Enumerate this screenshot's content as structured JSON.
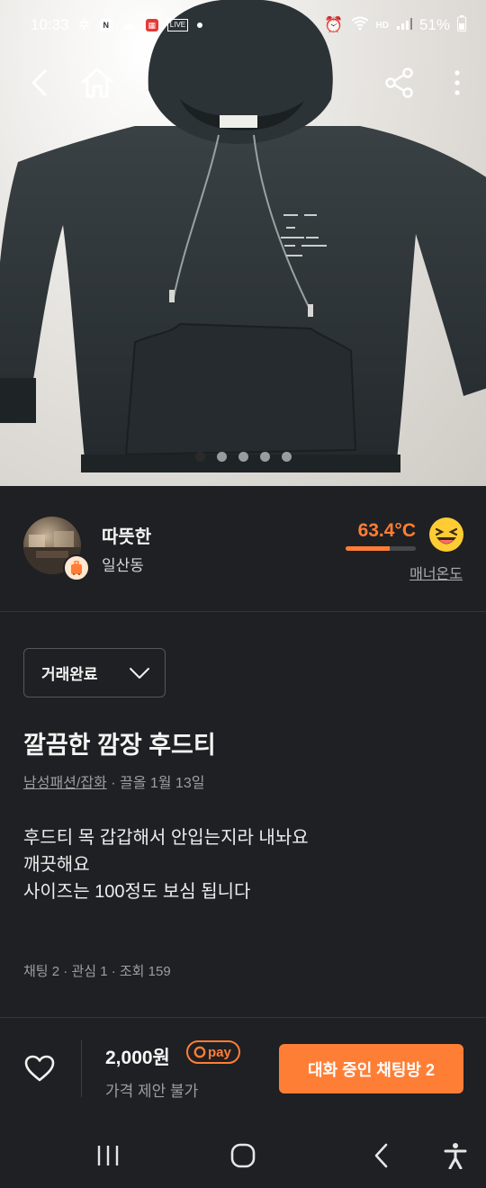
{
  "status_bar": {
    "time": "10:33",
    "battery": "51%",
    "net": "HD"
  },
  "carousel": {
    "count": 5,
    "active_index": 0,
    "icons": [
      "back-icon",
      "home-icon",
      "share-icon",
      "more-icon"
    ]
  },
  "seller": {
    "name": "따뜻한",
    "location": "일산동",
    "temperature": "63.4°C",
    "temperature_value": 63.4,
    "manner_label": "매너온도",
    "accent_color": "#ff7e36"
  },
  "listing": {
    "status": "거래완료",
    "title": "깔끔한 깜장 후드티",
    "category": "남성패션/잡화",
    "bump_info": " · 끌올 1월 13일",
    "description_lines": [
      "후드티 목 갑갑해서 안입는지라 내놔요",
      "깨끗해요",
      "사이즈는 100정도 보심 됩니다"
    ],
    "stats": "채팅 2 · 관심 1 · 조회 159"
  },
  "bottom_bar": {
    "price": "2,000원",
    "pay_label": "pay",
    "negotiation": "가격 제안 불가",
    "chat_button": "대화 중인 채팅방 2"
  }
}
